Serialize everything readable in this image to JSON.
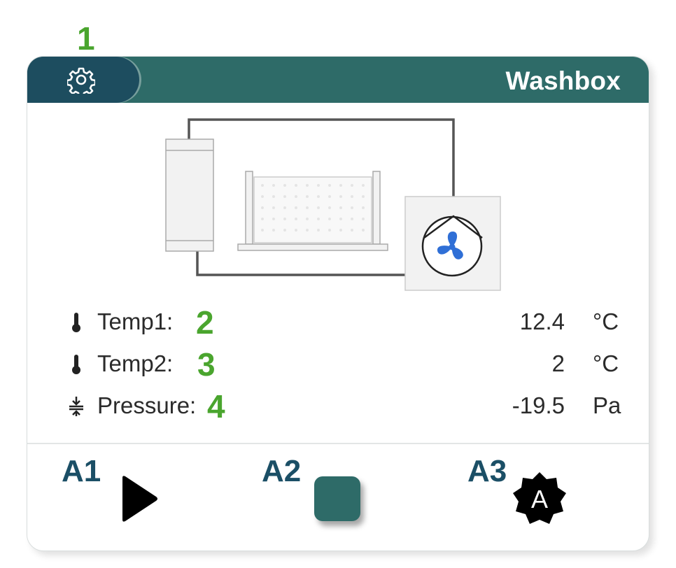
{
  "annotations": {
    "settings_marker": "1",
    "temp1_marker": "2",
    "temp2_marker": "3",
    "pressure_marker": "4",
    "action1_marker": "A1",
    "action2_marker": "A2",
    "action3_marker": "A3"
  },
  "header": {
    "title": "Washbox",
    "settings_icon": "gear-icon"
  },
  "readings": [
    {
      "label": "Temp1:",
      "value": "12.4",
      "unit": "°C",
      "icon": "thermometer-icon"
    },
    {
      "label": "Temp2:",
      "value": "2",
      "unit": "°C",
      "icon": "thermometer-icon"
    },
    {
      "label": "Pressure:",
      "value": "-19.5",
      "unit": "Pa",
      "icon": "pressure-icon"
    }
  ],
  "actions": {
    "start": {
      "icon": "play-icon"
    },
    "stop": {
      "icon": "stop-icon"
    },
    "auto": {
      "icon": "auto-mode-icon",
      "letter": "A"
    }
  },
  "schematic": {
    "fan_icon": "fan-icon",
    "fan_color": "#2f6fd6"
  },
  "colors": {
    "header": "#2e6b68",
    "settings_tab": "#1d4d5f",
    "stop_button": "#2e6b68",
    "annotation_green": "#4aa52e",
    "annotation_blue": "#1b4f66"
  }
}
